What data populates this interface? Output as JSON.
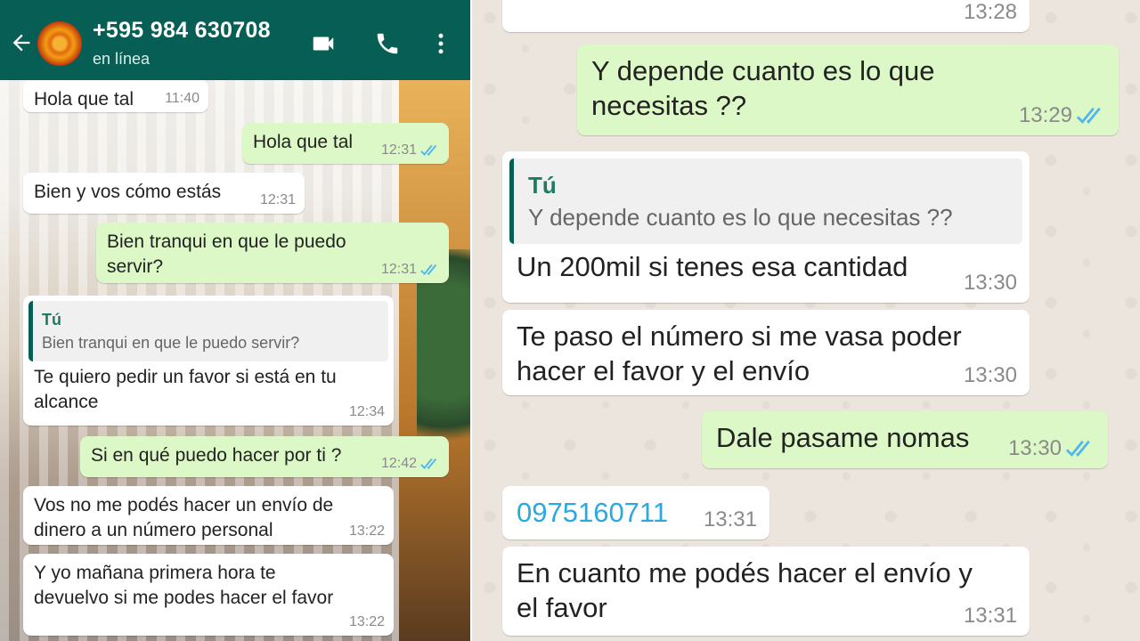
{
  "header": {
    "contact_name": "+595 984 630708",
    "status": "en línea",
    "back_icon": "arrow-left-icon",
    "video_icon": "video-call-icon",
    "phone_icon": "phone-icon",
    "menu_icon": "more-vertical-icon",
    "bar_color": "#075e54"
  },
  "left_messages": [
    {
      "dir": "in",
      "text": "Hola que tal",
      "time": "11:40"
    },
    {
      "dir": "out",
      "text": "Hola que tal",
      "time": "12:31"
    },
    {
      "dir": "in",
      "text": "Bien y vos cómo estás",
      "time": "12:31"
    },
    {
      "dir": "out",
      "text": "Bien tranqui en que le puedo servir?",
      "time": "12:31"
    },
    {
      "dir": "in",
      "quote_author": "Tú",
      "quote_text": "Bien tranqui en que le puedo servir?",
      "text": "Te quiero pedir un favor si está en tu\nalcance",
      "time": "12:34"
    },
    {
      "dir": "out",
      "text": "Si en qué puedo hacer por ti ?",
      "time": "12:42"
    },
    {
      "dir": "in",
      "text": "Vos no me podés hacer un envío de\ndinero a un número personal",
      "time": "13:22"
    },
    {
      "dir": "in",
      "text": "Y yo mañana primera hora te\ndevuelvo si me podes hacer el favor",
      "time": "13:22"
    }
  ],
  "right_messages": [
    {
      "dir": "in",
      "text": "",
      "time": "13:28"
    },
    {
      "dir": "out",
      "text": "Y depende cuanto es lo que\nnecesitas ??",
      "time": "13:29"
    },
    {
      "dir": "in",
      "quote_author": "Tú",
      "quote_text": "Y depende cuanto es lo que necesitas ??",
      "text": "Un 200mil si tenes esa cantidad",
      "time": "13:30"
    },
    {
      "dir": "in",
      "text": "Te paso el número si me vasa poder\nhacer el favor y el envío",
      "time": "13:30"
    },
    {
      "dir": "out",
      "text": "Dale pasame nomas",
      "time": "13:30"
    },
    {
      "dir": "in",
      "text": "0975160711",
      "time": "13:31",
      "link": true
    },
    {
      "dir": "in",
      "text": "En cuanto me podés hacer el envío y\nel favor",
      "time": "13:31"
    }
  ],
  "colors": {
    "incoming": "#ffffff",
    "outgoing": "#dcf8c6",
    "read_ticks": "#4fb6ec",
    "link": "#2aa8e0"
  }
}
